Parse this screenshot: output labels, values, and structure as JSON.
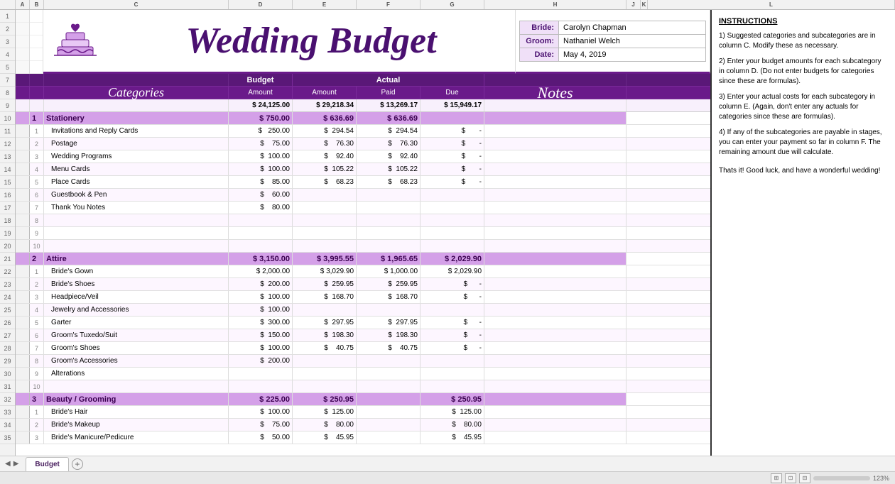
{
  "app": {
    "title": "Wedding Budget",
    "tab_label": "Budget"
  },
  "bride": "Carolyn Chapman",
  "groom": "Nathaniel Welch",
  "date": "May 4, 2019",
  "labels": {
    "bride": "Bride:",
    "groom": "Groom:",
    "date": "Date:",
    "budget": "Budget",
    "actual": "Actual",
    "amount": "Amount",
    "paid": "Paid",
    "due": "Due",
    "categories": "Categories",
    "notes": "Notes"
  },
  "totals": {
    "budget_amount": "$ 24,125.00",
    "actual_amount": "$ 29,218.34",
    "paid": "$ 13,269.17",
    "due": "$ 15,949.17"
  },
  "sections": [
    {
      "num": "1",
      "name": "Stationery",
      "budget": "$ 750.00",
      "actual": "$ 636.69",
      "paid": "$ 636.69",
      "due": "",
      "items": [
        {
          "num": "1",
          "name": "Invitations and Reply Cards",
          "budget": "250.00",
          "actual": "294.54",
          "paid": "294.54",
          "due": "-"
        },
        {
          "num": "2",
          "name": "Postage",
          "budget": "75.00",
          "actual": "76.30",
          "paid": "76.30",
          "due": "-"
        },
        {
          "num": "3",
          "name": "Wedding Programs",
          "budget": "100.00",
          "actual": "92.40",
          "paid": "92.40",
          "due": "-"
        },
        {
          "num": "4",
          "name": "Menu Cards",
          "budget": "100.00",
          "actual": "105.22",
          "paid": "105.22",
          "due": "-"
        },
        {
          "num": "5",
          "name": "Place Cards",
          "budget": "85.00",
          "actual": "68.23",
          "paid": "68.23",
          "due": "-"
        },
        {
          "num": "6",
          "name": "Guestbook & Pen",
          "budget": "60.00",
          "actual": "",
          "paid": "",
          "due": ""
        },
        {
          "num": "7",
          "name": "Thank You Notes",
          "budget": "80.00",
          "actual": "",
          "paid": "",
          "due": ""
        },
        {
          "num": "8",
          "name": "",
          "budget": "",
          "actual": "",
          "paid": "",
          "due": ""
        },
        {
          "num": "9",
          "name": "",
          "budget": "",
          "actual": "",
          "paid": "",
          "due": ""
        },
        {
          "num": "10",
          "name": "",
          "budget": "",
          "actual": "",
          "paid": "",
          "due": ""
        }
      ]
    },
    {
      "num": "2",
      "name": "Attire",
      "budget": "$ 3,150.00",
      "actual": "$ 3,995.55",
      "paid": "$ 1,965.65",
      "due": "$ 2,029.90",
      "items": [
        {
          "num": "1",
          "name": "Bride's Gown",
          "budget": "2,000.00",
          "actual": "3,029.90",
          "paid": "1,000.00",
          "due": "2,029.90"
        },
        {
          "num": "2",
          "name": "Bride's Shoes",
          "budget": "200.00",
          "actual": "259.95",
          "paid": "259.95",
          "due": "-"
        },
        {
          "num": "3",
          "name": "Headpiece/Veil",
          "budget": "100.00",
          "actual": "168.70",
          "paid": "168.70",
          "due": "-"
        },
        {
          "num": "4",
          "name": "Jewelry and Accessories",
          "budget": "100.00",
          "actual": "",
          "paid": "",
          "due": ""
        },
        {
          "num": "5",
          "name": "Garter",
          "budget": "300.00",
          "actual": "297.95",
          "paid": "297.95",
          "due": "-"
        },
        {
          "num": "6",
          "name": "Groom's Tuxedo/Suit",
          "budget": "150.00",
          "actual": "198.30",
          "paid": "198.30",
          "due": "-"
        },
        {
          "num": "7",
          "name": "Groom's Shoes",
          "budget": "100.00",
          "actual": "40.75",
          "paid": "40.75",
          "due": "-"
        },
        {
          "num": "8",
          "name": "Groom's Accessories",
          "budget": "200.00",
          "actual": "",
          "paid": "",
          "due": ""
        },
        {
          "num": "9",
          "name": "Alterations",
          "budget": "",
          "actual": "",
          "paid": "",
          "due": ""
        },
        {
          "num": "10",
          "name": "",
          "budget": "",
          "actual": "",
          "paid": "",
          "due": ""
        }
      ]
    },
    {
      "num": "3",
      "name": "Beauty / Grooming",
      "budget": "$ 225.00",
      "actual": "$ 250.95",
      "paid": "",
      "due": "$ 250.95",
      "items": [
        {
          "num": "1",
          "name": "Bride's Hair",
          "budget": "100.00",
          "actual": "125.00",
          "paid": "",
          "due": "125.00"
        },
        {
          "num": "2",
          "name": "Bride's Makeup",
          "budget": "75.00",
          "actual": "80.00",
          "paid": "",
          "due": "80.00"
        },
        {
          "num": "3",
          "name": "Bride's Manicure/Pedicure",
          "budget": "50.00",
          "actual": "45.95",
          "paid": "",
          "due": "45.95"
        }
      ]
    }
  ],
  "instructions": {
    "title": "INSTRUCTIONS",
    "items": [
      "Suggested categories and subcategories are in column C.  Modify these as necessary.",
      "Enter your budget amounts for each subcategory in column D.  (Do not enter budgets for categories since these are formulas).",
      "Enter your actual costs for each subcategory in column E.  (Again, don't enter any actuals for categories since these are formulas).",
      "If any of the subcategories are payable in stages, you can enter your payment so far in column F.  The remaining amount due will calculate."
    ],
    "closing": "Thats it!  Good luck, and have a wonderful wedding!"
  },
  "columns": {
    "ab": "A",
    "b": "B",
    "c": "C",
    "d": "D",
    "e": "E",
    "f": "F",
    "g": "G",
    "h": "H",
    "ij": "J"
  }
}
